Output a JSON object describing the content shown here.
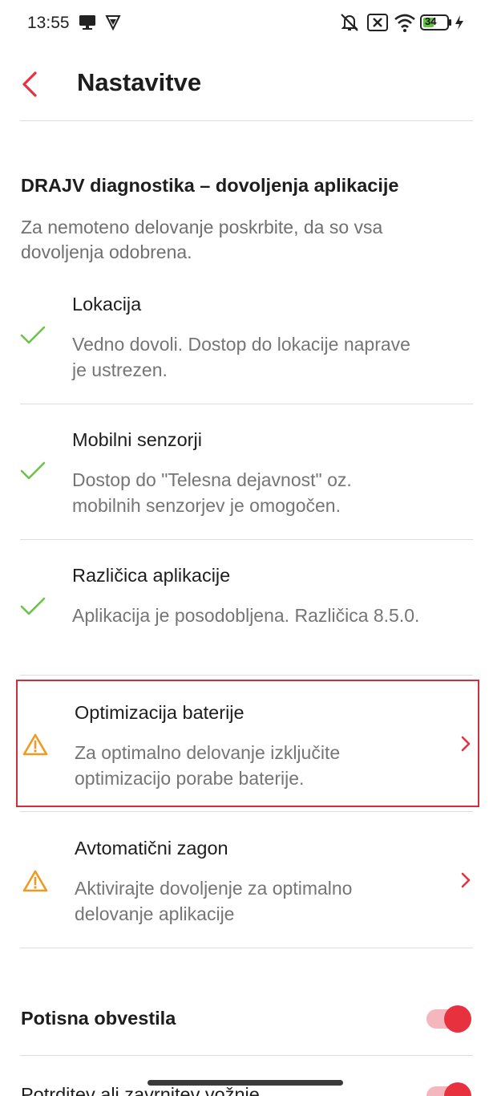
{
  "status_bar": {
    "time": "13:55",
    "battery": "34",
    "icons": [
      "desktop-icon",
      "vpn-shield-icon",
      "mute-icon",
      "no-sim-icon",
      "wifi-icon",
      "battery-icon",
      "charging-icon"
    ]
  },
  "header": {
    "title": "Nastavitve",
    "back_icon": "chevron-left-icon"
  },
  "section": {
    "title": "DRAJV diagnostika – dovoljenja aplikacije",
    "description": "Za nemoteno delovanje poskrbite, da so vsa dovoljenja odobrena."
  },
  "permissions": [
    {
      "title": "Lokacija",
      "description": "Vedno dovoli. Dostop do lokacije naprave je ustrezen.",
      "status": "ok",
      "icon": "check-icon"
    },
    {
      "title": "Mobilni senzorji",
      "description": "Dostop do \"Telesna dejavnost\" oz. mobilnih senzorjev je omogočen.",
      "status": "ok",
      "icon": "check-icon"
    },
    {
      "title": "Različica aplikacije",
      "description": "Aplikacija je posodobljena. Različica 8.5.0.",
      "status": "ok",
      "icon": "check-icon"
    },
    {
      "title": "Optimizacija baterije",
      "description": "Za optimalno delovanje izključite optimizacijo porabe baterije.",
      "status": "warning",
      "icon": "warning-icon"
    },
    {
      "title": "Avtomatični zagon",
      "description": "Aktivirajte dovoljenje za optimalno delovanje aplikacije",
      "status": "warning",
      "icon": "warning-icon"
    }
  ],
  "toggles": [
    {
      "label": "Potisna obvestila",
      "on": true
    },
    {
      "label": "Potrditev ali zavrnitev vožnje",
      "on": true
    }
  ],
  "colors": {
    "accent": "#e8313f",
    "check": "#6cc24a",
    "warning": "#f29a1f",
    "highlight_border": "#d32f3a"
  }
}
